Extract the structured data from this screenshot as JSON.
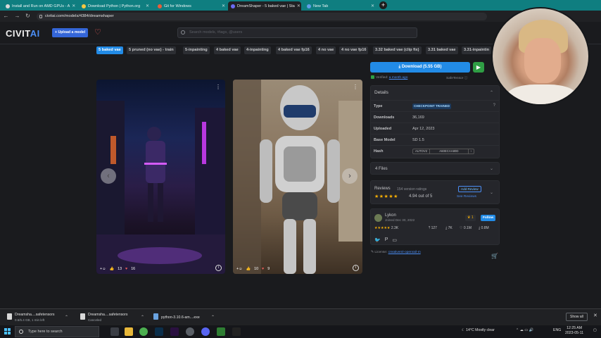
{
  "browser": {
    "tabs": [
      {
        "label": "Install and Run on AMD GPUs - A",
        "active": false
      },
      {
        "label": "Download Python | Python.org",
        "active": false
      },
      {
        "label": "Git for Windows",
        "active": false
      },
      {
        "label": "DreamShaper - 5 baked vae | Sta",
        "active": true
      },
      {
        "label": "New Tab",
        "active": false
      }
    ],
    "new_tab": "+",
    "url": "civitai.com/models/4384/dreamshaper"
  },
  "site": {
    "logo_main": "CIVIT",
    "logo_accent": "AI",
    "upload_label": "+ Upload a model",
    "search_placeholder": "Search models, #tags, @users"
  },
  "versions": [
    "5 baked vae",
    "5 pruned (no vae) - train",
    "5-inpainting",
    "4 baked vae",
    "4-inpainting",
    "4 baked vae fp16",
    "4 no vae",
    "4 no vae fp16",
    "3.32 baked vae (clip fix)",
    "3.31 baked vae",
    "3.31-inpaintin"
  ],
  "images": [
    {
      "likes": "13",
      "hearts": "16"
    },
    {
      "likes": "10",
      "hearts": "9"
    }
  ],
  "download": {
    "label": "Download (5.55 GB)",
    "verified_prefix": "Verified:",
    "verified_when": "a month ago",
    "format": "SafeTensor"
  },
  "details": {
    "title": "Details",
    "rows": [
      {
        "key": "Type",
        "value": "CHECKPOINT TRAINED"
      },
      {
        "key": "Downloads",
        "value": "36,169"
      },
      {
        "key": "Uploaded",
        "value": "Apr 12, 2023"
      },
      {
        "key": "Base Model",
        "value": "SD 1.5"
      },
      {
        "key": "Hash",
        "algo": "AUTOV2",
        "value": "A60ECAA80D"
      }
    ]
  },
  "files": {
    "label": "4 Files"
  },
  "reviews": {
    "label": "Reviews",
    "count": "154 version ratings",
    "rating_text": "4.94 out of 5",
    "stars": 4.94,
    "add_review": "Add Review",
    "see_reviews": "See Reviews"
  },
  "creator": {
    "name": "Lykon",
    "joined": "Joined Dec 30, 2022",
    "rank": "1",
    "follow": "Follow",
    "rating_count": "2.3K",
    "uploads": "127",
    "favorites": "7K",
    "likes": "0.1M",
    "downloads": "0.8M"
  },
  "license": {
    "prefix": "License:",
    "name": "creativeml-openrail-m"
  },
  "downloads_bar": {
    "items": [
      {
        "name": "Dreamsha....safetensors",
        "status": "0.6/5.4 GB, 1 min left"
      },
      {
        "name": "Dreamsha....safetensors",
        "status": "Canceled"
      },
      {
        "name": "python-3.10.6-am....exe",
        "status": ""
      }
    ],
    "show_all": "Show all"
  },
  "taskbar": {
    "search_placeholder": "Type here to search",
    "weather": "14°C  Mostly clear",
    "lang": "ENG",
    "time": "12:25 AM",
    "date": "2023-05-11"
  }
}
